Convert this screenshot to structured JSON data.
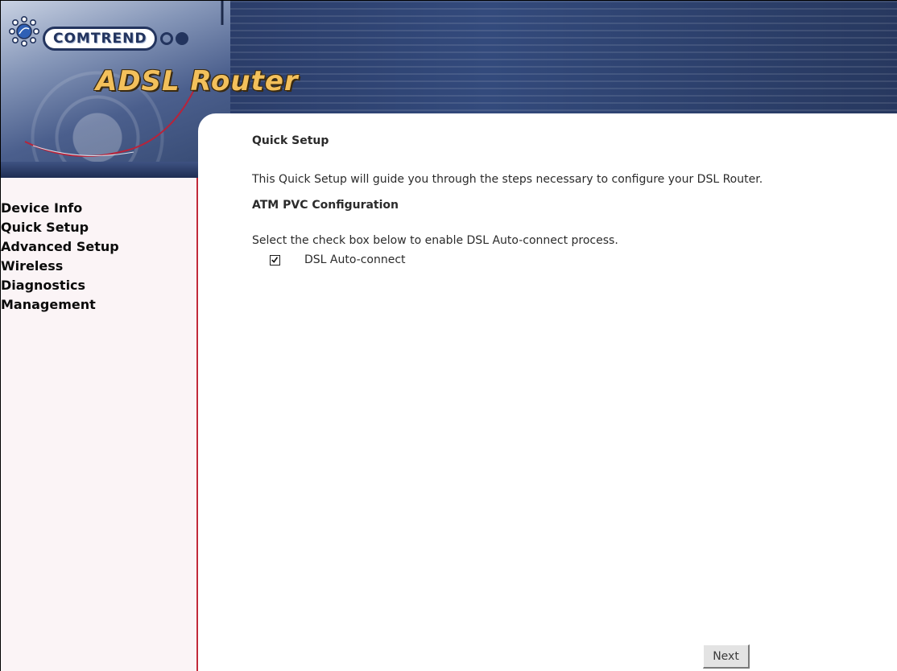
{
  "header": {
    "brand": "COMTREND",
    "product": "ADSL Router",
    "icons": [
      "sun-logo-icon"
    ]
  },
  "sidebar": {
    "items": [
      {
        "label": "Device Info"
      },
      {
        "label": "Quick Setup"
      },
      {
        "label": "Advanced Setup"
      },
      {
        "label": "Wireless"
      },
      {
        "label": "Diagnostics"
      },
      {
        "label": "Management"
      }
    ]
  },
  "main": {
    "title": "Quick Setup",
    "intro": "This Quick Setup will guide you through the steps necessary to configure your DSL Router.",
    "section_title": "ATM PVC Configuration",
    "instruction": "Select the check box below to enable DSL Auto-connect process.",
    "auto_connect": {
      "label": "DSL Auto-connect",
      "checked": true
    },
    "next_label": "Next"
  },
  "colors": {
    "sidebar_border": "#c22a3a",
    "sidebar_bg": "#fbf4f6",
    "product_title": "#f3c05b",
    "banner_dark": "#2c3f6c"
  }
}
